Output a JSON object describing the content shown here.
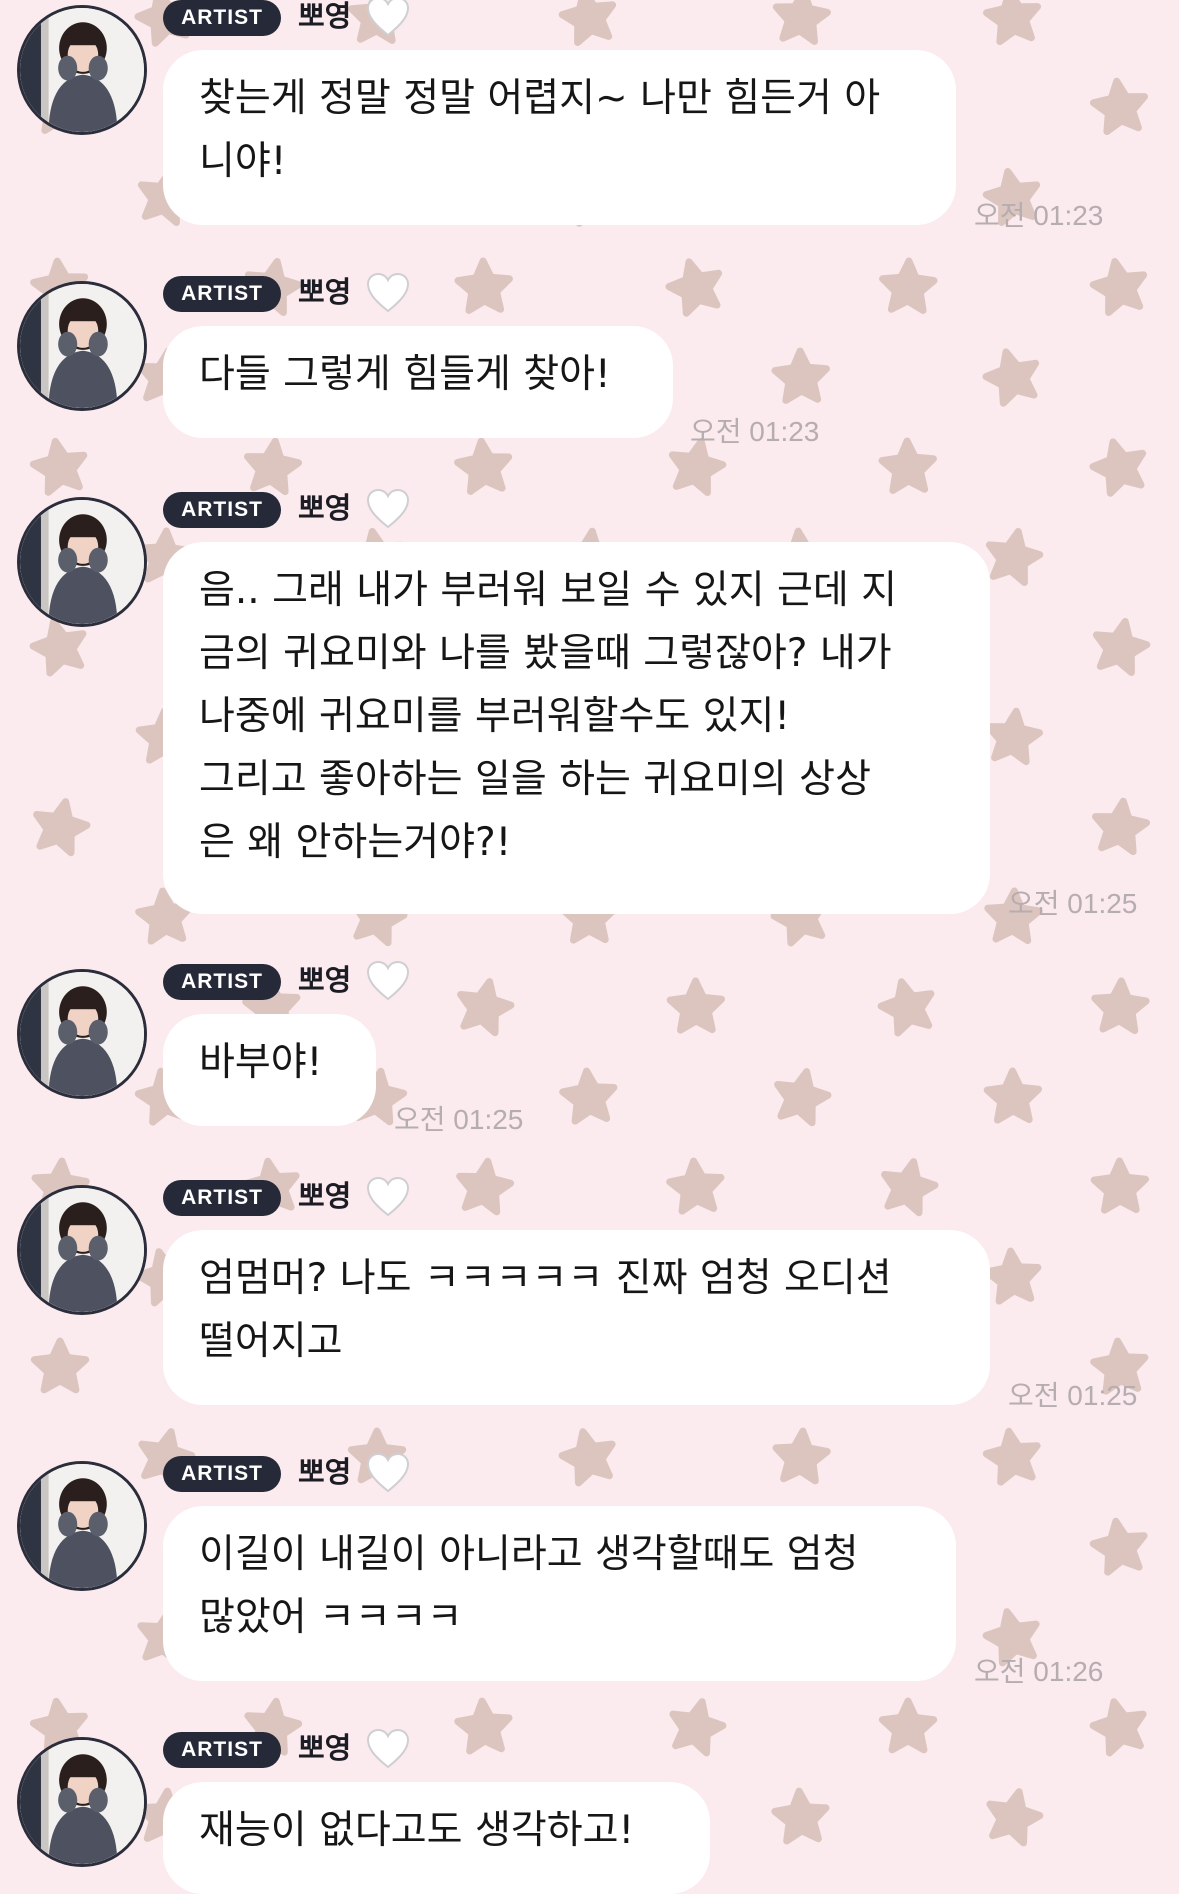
{
  "messages": [
    {
      "badge": "ARTIST",
      "name": "뽀영",
      "text": "찾는게 정말 정말 어렵지~ 나만 힘든거 아\n니야!",
      "time": "오전 01:23"
    },
    {
      "badge": "ARTIST",
      "name": "뽀영",
      "text": "다들 그렇게 힘들게 찾아!",
      "time": "오전 01:23"
    },
    {
      "badge": "ARTIST",
      "name": "뽀영",
      "text": "음.. 그래 내가 부러워 보일 수 있지 근데 지\n금의 귀요미와 나를 봤을때 그렇잖아? 내가\n나중에 귀요미를 부러워할수도 있지!\n그리고 좋아하는 일을 하는 귀요미의 상상\n은 왜 안하는거야?!",
      "time": "오전 01:25"
    },
    {
      "badge": "ARTIST",
      "name": "뽀영",
      "text": "바부야!",
      "time": "오전 01:25"
    },
    {
      "badge": "ARTIST",
      "name": "뽀영",
      "text": "엄멈머? 나도 ㅋㅋㅋㅋㅋ 진짜 엄청 오디션\n떨어지고",
      "time": "오전 01:25"
    },
    {
      "badge": "ARTIST",
      "name": "뽀영",
      "text": "이길이 내길이 아니라고 생각할때도 엄청\n많았어 ㅋㅋㅋㅋ",
      "time": "오전 01:26"
    },
    {
      "badge": "ARTIST",
      "name": "뽀영",
      "text": "재능이 없다고도 생각하고!",
      "time": ""
    }
  ],
  "icons": {
    "avatar": "avatar-photo",
    "heart": "white-heart-icon",
    "background": "star-pattern"
  },
  "colors": {
    "background": "#fbeaee",
    "star": "#dcc5bf",
    "badge": "#262a38",
    "bubble": "#ffffff",
    "timestamp": "#b6adb0"
  }
}
